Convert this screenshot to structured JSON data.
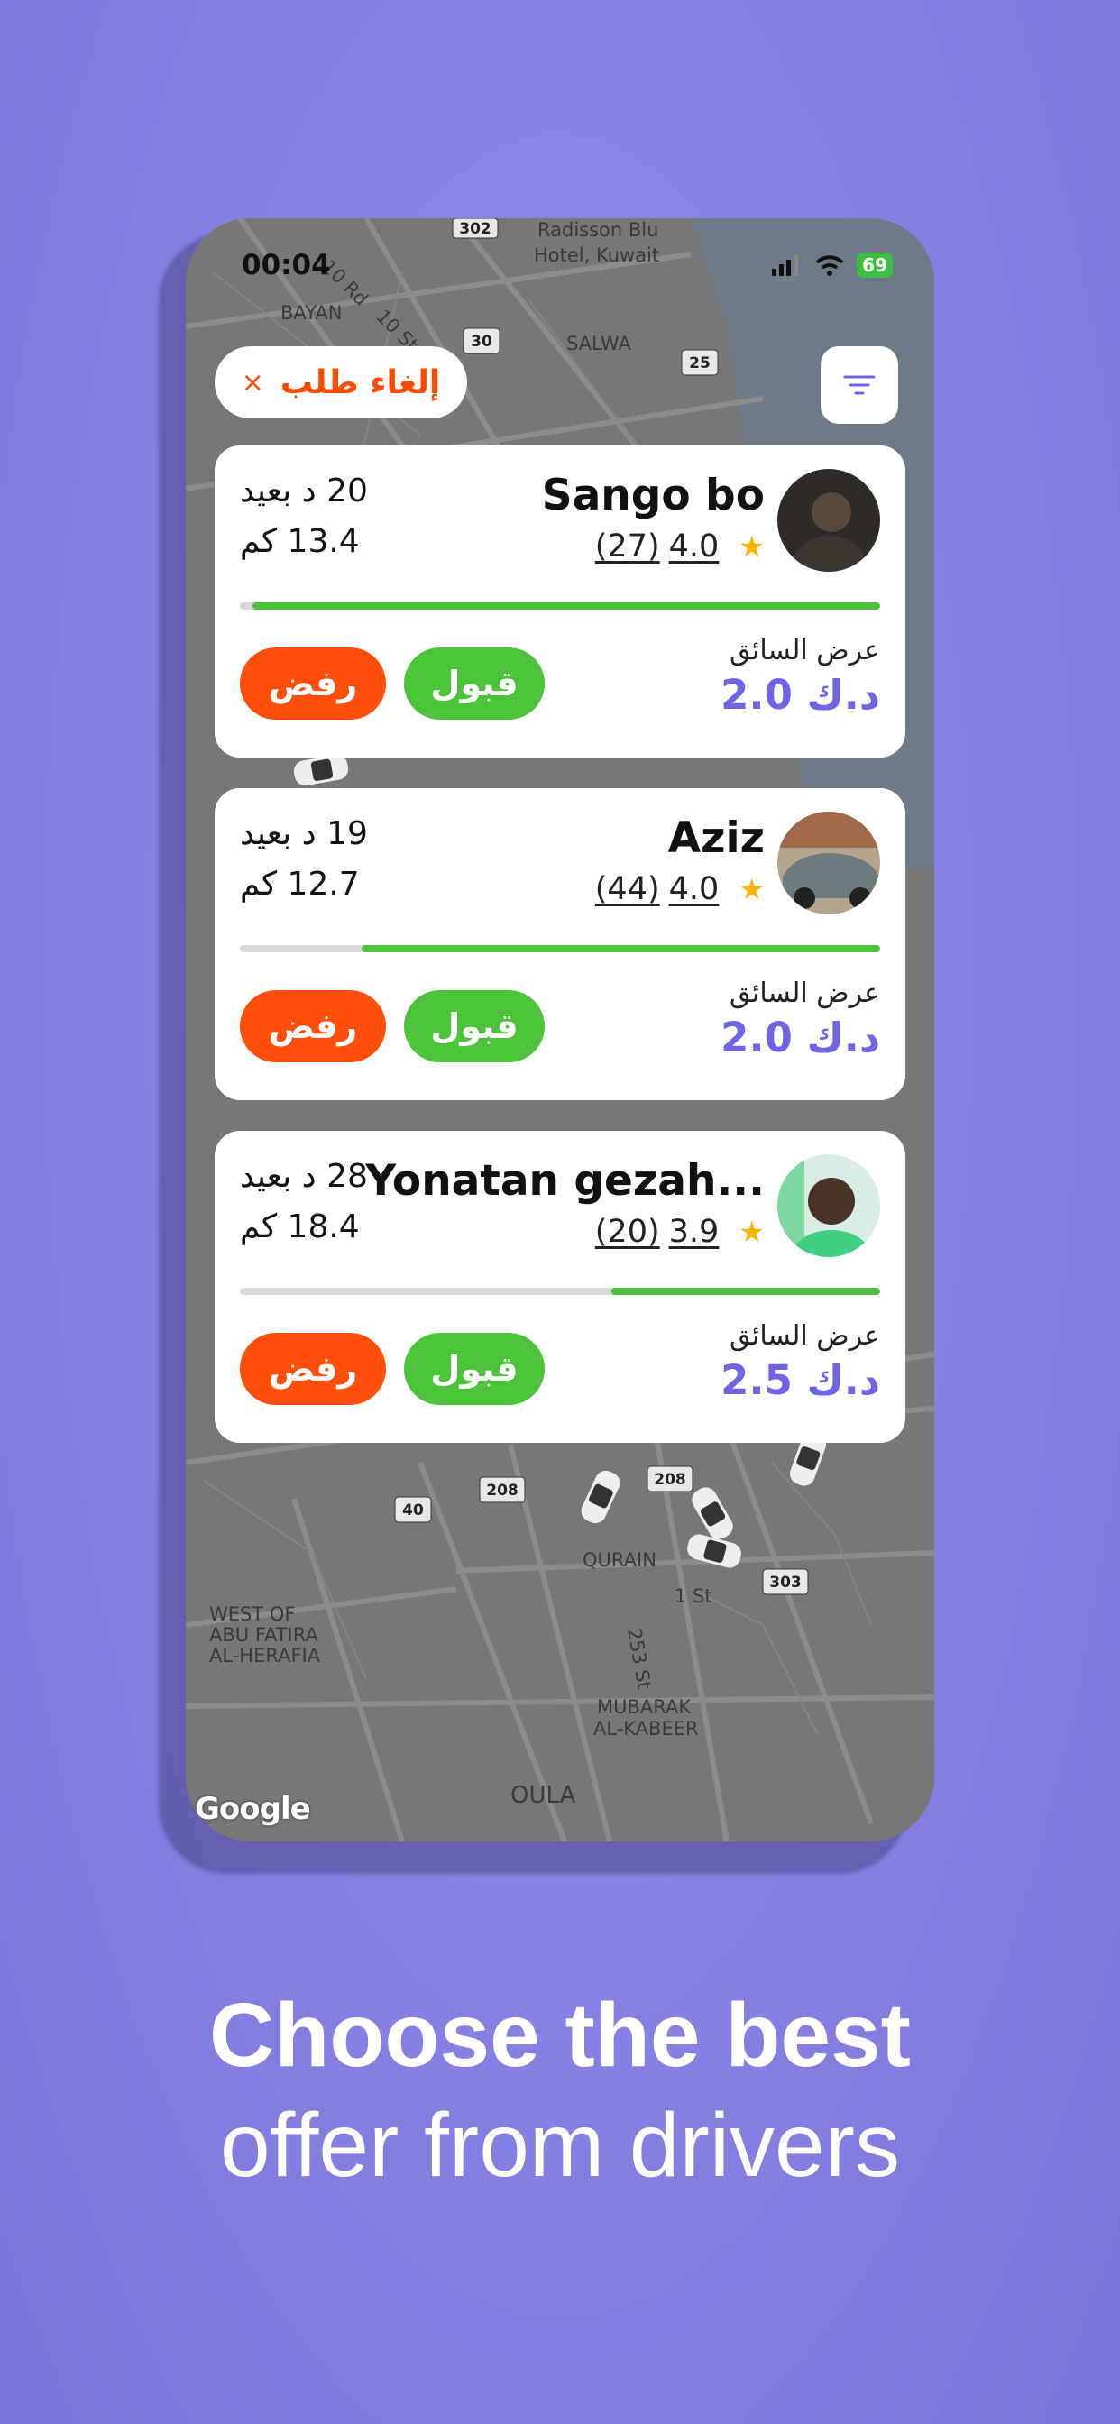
{
  "status": {
    "time": "00:04",
    "battery": "69"
  },
  "map": {
    "labels": [
      "Radisson Blu",
      "Hotel, Kuwait",
      "BAYAN",
      "SALWA",
      "QURAIN",
      "MUBARAK",
      "AL-KABEER",
      "WEST OF",
      "ABU FATIRA",
      "AL-HERAFIA",
      "OULA",
      "1 St",
      "253 St",
      "10 Rd",
      "10 St"
    ],
    "road_badges": [
      "302",
      "30",
      "25",
      "40",
      "208",
      "208",
      "303"
    ],
    "attribution": "Google"
  },
  "cancel_button": {
    "label": "إلغاء طلب",
    "icon": "×"
  },
  "offers": [
    {
      "name": "Sango bo",
      "rating": "4.0",
      "reviews": "(27)",
      "eta": "20 د بعيد",
      "distance": "13.4 كم",
      "offer_label": "عرض السائق",
      "price": "2.0 د.ك",
      "accept": "قبول",
      "reject": "رفض",
      "progress": 0.98
    },
    {
      "name": "Aziz",
      "rating": "4.0",
      "reviews": "(44)",
      "eta": "19 د بعيد",
      "distance": "12.7 كم",
      "offer_label": "عرض السائق",
      "price": "2.0 د.ك",
      "accept": "قبول",
      "reject": "رفض",
      "progress": 0.81
    },
    {
      "name": "Yonatan gezah...",
      "rating": "3.9",
      "reviews": "(20)",
      "eta": "28 د بعيد",
      "distance": "18.4 كم",
      "offer_label": "عرض السائق",
      "price": "2.5 د.ك",
      "accept": "قبول",
      "reject": "رفض",
      "progress": 0.42
    }
  ],
  "headline": {
    "line1": "Choose the best",
    "line2": "offer from drivers"
  },
  "colors": {
    "accent": "#6f64e6",
    "accept": "#4cc43a",
    "reject": "#ff4f0a",
    "star": "#f7b500",
    "background": "#8883e4"
  }
}
